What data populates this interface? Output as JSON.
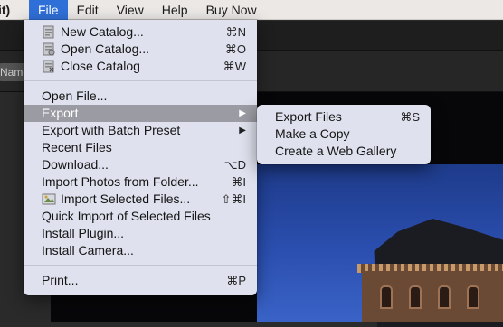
{
  "menubar": {
    "app_label": "it)",
    "items": [
      {
        "label": "File",
        "active": true
      },
      {
        "label": "Edit"
      },
      {
        "label": "View"
      },
      {
        "label": "Help"
      },
      {
        "label": "Buy Now"
      }
    ]
  },
  "app": {
    "name_pill": "Name"
  },
  "file_menu": {
    "group1": [
      {
        "label": "New Catalog...",
        "shortcut": "⌘N",
        "icon": "catalog-new-icon"
      },
      {
        "label": "Open Catalog...",
        "shortcut": "⌘O",
        "icon": "catalog-open-icon"
      },
      {
        "label": "Close Catalog",
        "shortcut": "⌘W",
        "icon": "catalog-close-icon"
      }
    ],
    "group2": [
      {
        "label": "Open File...",
        "shortcut": ""
      },
      {
        "label": "Export",
        "shortcut": "",
        "submenu": true,
        "highlighted": true
      },
      {
        "label": "Export with Batch Preset",
        "shortcut": "",
        "submenu": true
      },
      {
        "label": "Recent Files",
        "shortcut": ""
      },
      {
        "label": "Download...",
        "shortcut": "⌥D"
      },
      {
        "label": "Import Photos from Folder...",
        "shortcut": "⌘I"
      },
      {
        "label": "Import Selected Files...",
        "shortcut": "⇧⌘I",
        "icon": "import-selected-icon"
      },
      {
        "label": "Quick Import of Selected Files",
        "shortcut": ""
      },
      {
        "label": "Install Plugin...",
        "shortcut": ""
      },
      {
        "label": "Install Camera...",
        "shortcut": ""
      }
    ],
    "group3": [
      {
        "label": "Print...",
        "shortcut": "⌘P"
      }
    ]
  },
  "export_submenu": [
    {
      "label": "Export Files",
      "shortcut": "⌘S"
    },
    {
      "label": "Make a Copy",
      "shortcut": ""
    },
    {
      "label": "Create a Web Gallery",
      "shortcut": ""
    }
  ]
}
